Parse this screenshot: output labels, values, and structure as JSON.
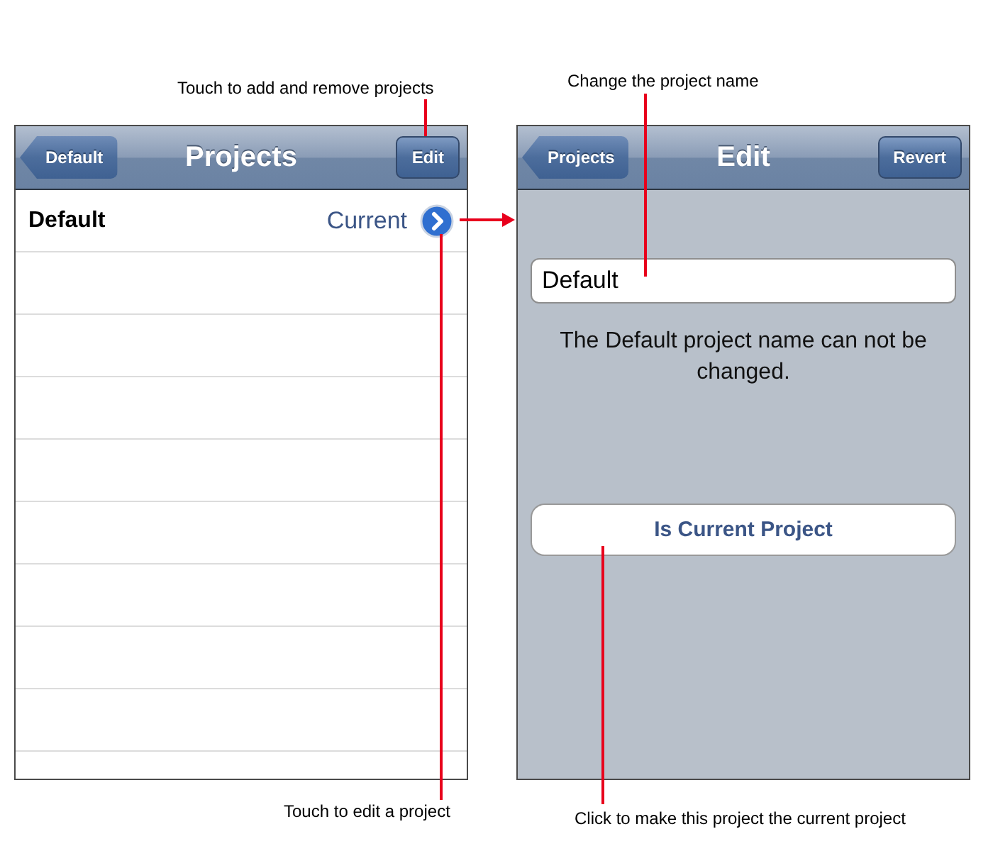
{
  "screens": [
    {
      "kind": "list",
      "nav": {
        "back": "Default",
        "title": "Projects",
        "action": "Edit"
      },
      "rows": [
        {
          "name": "Default",
          "detail": "Current"
        }
      ]
    },
    {
      "kind": "edit",
      "nav": {
        "back": "Projects",
        "title": "Edit",
        "action": "Revert"
      },
      "name_field": {
        "value": "Default"
      },
      "message": "The Default project name can not be changed.",
      "button": "Is Current Project"
    }
  ],
  "annotations": [
    {
      "text": "Touch to add and remove projects"
    },
    {
      "text": "Change the project name"
    },
    {
      "text": "Touch to edit a project"
    },
    {
      "text": "Click to make this project the current project"
    }
  ]
}
